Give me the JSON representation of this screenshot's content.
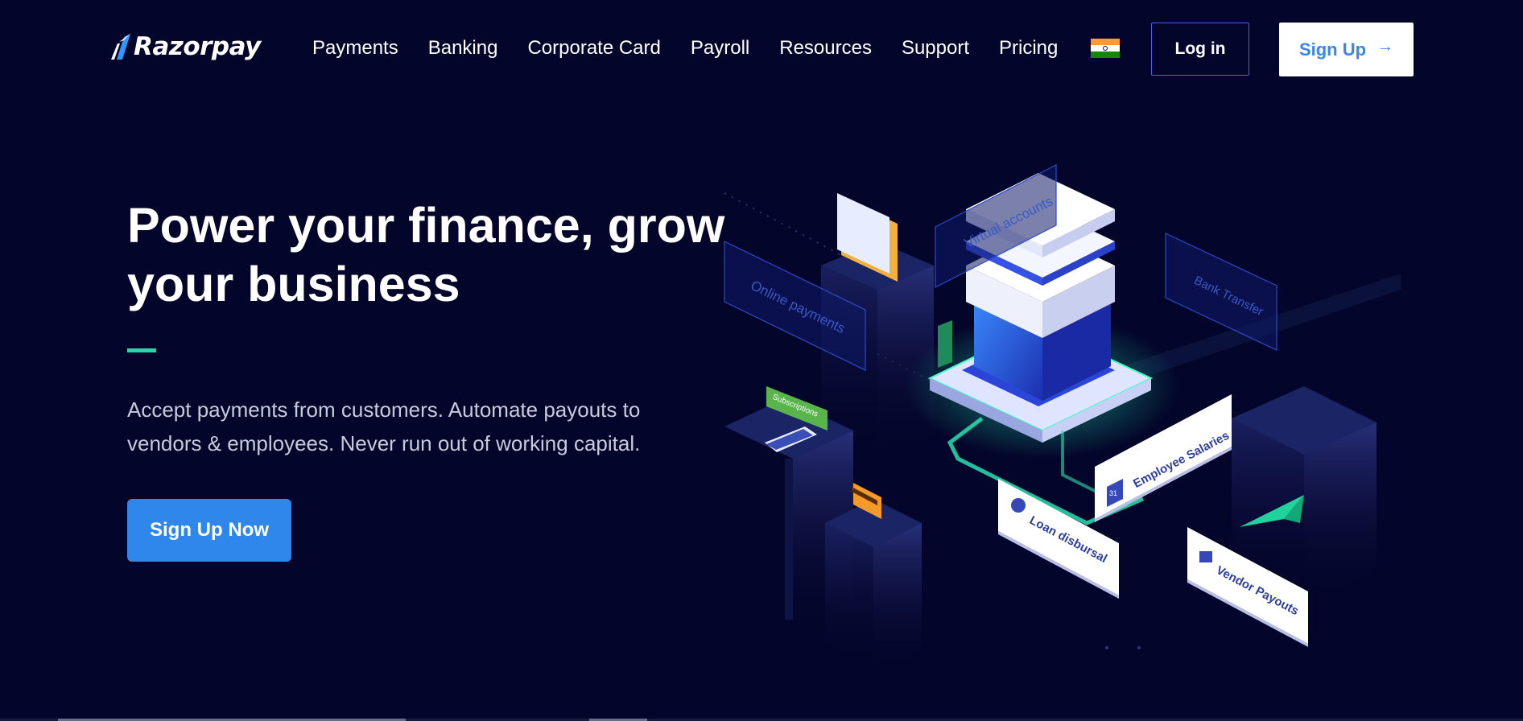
{
  "brand": {
    "name": "Razorpay",
    "logo_icon": "razorpay-logo-icon"
  },
  "nav": {
    "links": [
      "Payments",
      "Banking",
      "Corporate Card",
      "Payroll",
      "Resources",
      "Support",
      "Pricing"
    ],
    "flag_icon": "india-flag-icon",
    "login_label": "Log in",
    "signup_label": "Sign Up",
    "signup_icon": "arrow-right-icon"
  },
  "hero": {
    "title": "Power your finance, grow your business",
    "subtitle": "Accept payments from customers. Automate payouts to vendors & employees. Never run out of working capital.",
    "cta_label": "Sign Up Now"
  },
  "illustration": {
    "labels": {
      "virtual_accounts": "Virtual accounts",
      "online_payments": "Online payments",
      "bank_transfer": "Bank Transfer",
      "subscriptions": "Subscriptions",
      "employee_salaries": "Employee Salaries",
      "loan_disbursal": "Loan disbursal",
      "vendor_payouts": "Vendor Payouts",
      "calendar_day": "31"
    }
  },
  "colors": {
    "background": "#04052a",
    "primary_blue": "#2f86eb",
    "accent_green": "#2fd3a4",
    "login_border": "#3d6ae3"
  }
}
